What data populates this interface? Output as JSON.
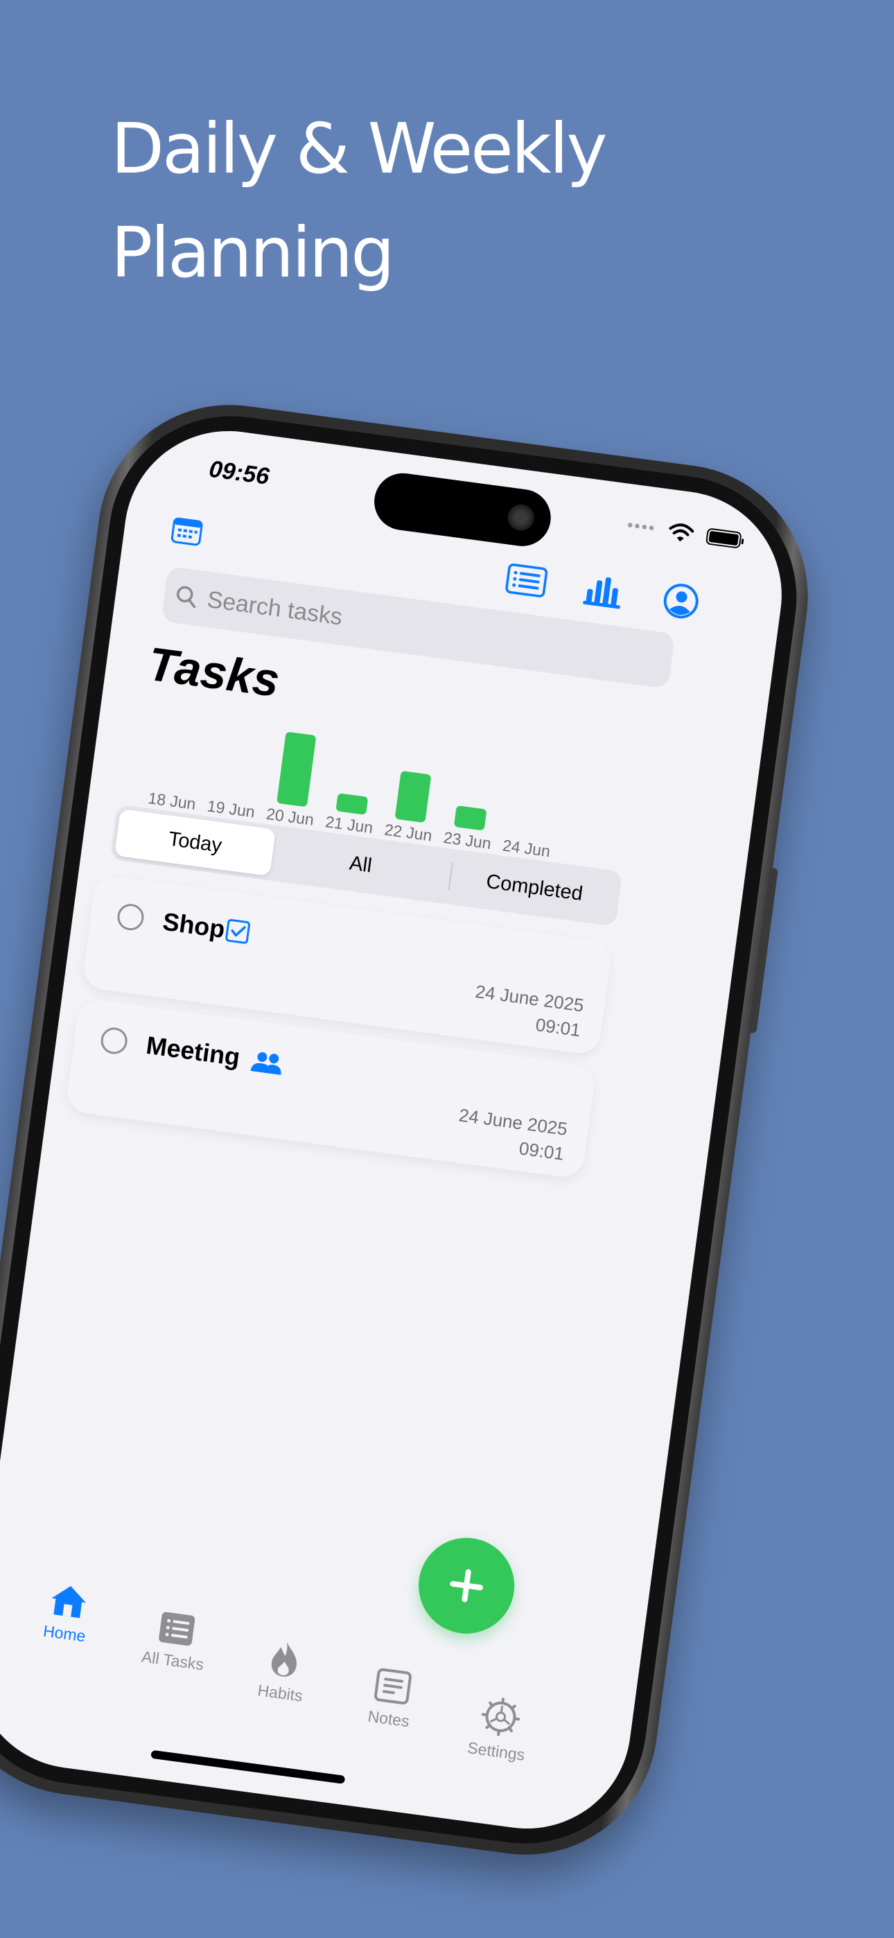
{
  "headline": {
    "line1": "Daily & Weekly",
    "line2": "Planning"
  },
  "status_bar": {
    "time": "09:56"
  },
  "search": {
    "placeholder": "Search tasks"
  },
  "page_title": "Tasks",
  "chart_data": {
    "type": "bar",
    "categories": [
      "18 Jun",
      "19 Jun",
      "20 Jun",
      "21 Jun",
      "22 Jun",
      "23 Jun",
      "24 Jun"
    ],
    "values": [
      0,
      0,
      4,
      1,
      2.7,
      1.2,
      0
    ],
    "title": "",
    "xlabel": "",
    "ylabel": "",
    "bar_color": "#34c759"
  },
  "segments": [
    {
      "label": "Today",
      "active": true
    },
    {
      "label": "All",
      "active": false
    },
    {
      "label": "Completed",
      "active": false
    }
  ],
  "tasks": [
    {
      "name": "Shop",
      "icon": "checkbox-icon",
      "date": "24 June 2025",
      "time": "09:01"
    },
    {
      "name": "Meeting",
      "icon": "people-icon",
      "date": "24 June 2025",
      "time": "09:01"
    }
  ],
  "tabbar": [
    {
      "label": "Home",
      "icon": "house-icon",
      "active": true
    },
    {
      "label": "All Tasks",
      "icon": "list-icon",
      "active": false
    },
    {
      "label": "Habits",
      "icon": "flame-icon",
      "active": false
    },
    {
      "label": "Notes",
      "icon": "note-icon",
      "active": false
    },
    {
      "label": "Settings",
      "icon": "gear-icon",
      "active": false
    }
  ],
  "colors": {
    "background": "#6282b7",
    "accent": "#0a7cff",
    "green": "#34c759"
  }
}
